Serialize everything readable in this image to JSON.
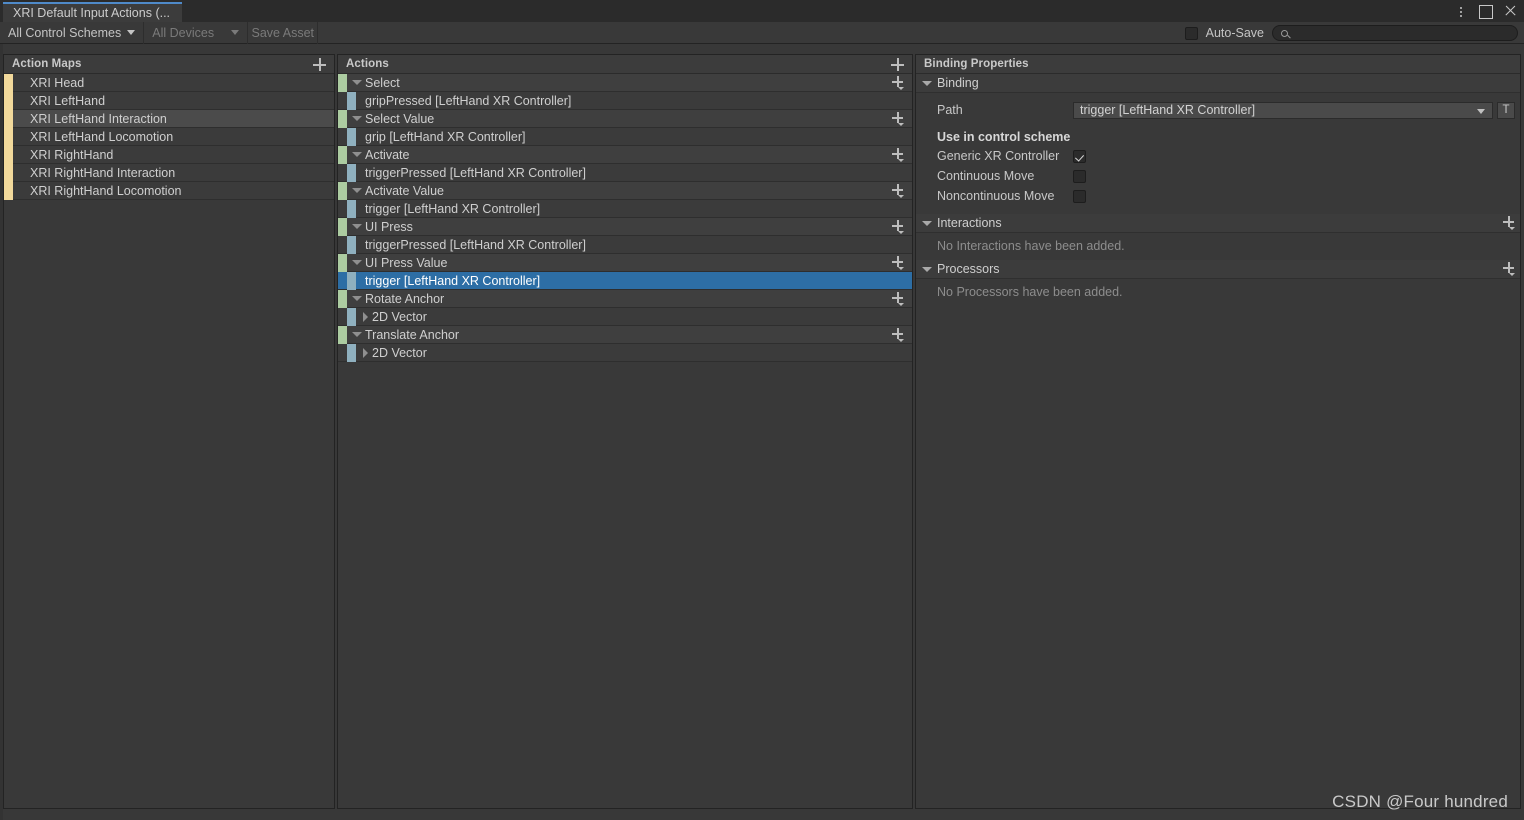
{
  "window": {
    "tab_title": "XRI Default Input Actions (...",
    "buttons": {
      "kebab": "more-options",
      "maximize": "maximize",
      "close": "close"
    }
  },
  "toolbar": {
    "control_schemes": "All Control Schemes",
    "devices": "All Devices",
    "save_asset": "Save Asset",
    "auto_save_label": "Auto-Save",
    "auto_save_checked": false,
    "search_value": "",
    "search_placeholder": ""
  },
  "action_maps": {
    "title": "Action Maps",
    "add_label": "+",
    "items": [
      {
        "label": "XRI Head",
        "selected": false
      },
      {
        "label": "XRI LeftHand",
        "selected": false
      },
      {
        "label": "XRI LeftHand Interaction",
        "selected": true
      },
      {
        "label": "XRI LeftHand Locomotion",
        "selected": false
      },
      {
        "label": "XRI RightHand",
        "selected": false
      },
      {
        "label": "XRI RightHand Interaction",
        "selected": false
      },
      {
        "label": "XRI RightHand Locomotion",
        "selected": false
      }
    ]
  },
  "actions": {
    "title": "Actions",
    "add_label": "+",
    "rows": [
      {
        "kind": "action",
        "label": "Select",
        "expanded": true
      },
      {
        "kind": "binding",
        "label": "gripPressed [LeftHand XR Controller]",
        "selected": false
      },
      {
        "kind": "action",
        "label": "Select Value",
        "expanded": true
      },
      {
        "kind": "binding",
        "label": "grip [LeftHand XR Controller]",
        "selected": false
      },
      {
        "kind": "action",
        "label": "Activate",
        "expanded": true
      },
      {
        "kind": "binding",
        "label": "triggerPressed [LeftHand XR Controller]",
        "selected": false
      },
      {
        "kind": "action",
        "label": "Activate Value",
        "expanded": true
      },
      {
        "kind": "binding",
        "label": "trigger [LeftHand XR Controller]",
        "selected": false
      },
      {
        "kind": "action",
        "label": "UI Press",
        "expanded": true
      },
      {
        "kind": "binding",
        "label": "triggerPressed [LeftHand XR Controller]",
        "selected": false
      },
      {
        "kind": "action",
        "label": "UI Press Value",
        "expanded": true
      },
      {
        "kind": "binding",
        "label": "trigger [LeftHand XR Controller]",
        "selected": true
      },
      {
        "kind": "action",
        "label": "Rotate Anchor",
        "expanded": true
      },
      {
        "kind": "composite",
        "label": "2D Vector",
        "expanded": false
      },
      {
        "kind": "action",
        "label": "Translate Anchor",
        "expanded": true
      },
      {
        "kind": "composite",
        "label": "2D Vector",
        "expanded": false
      }
    ]
  },
  "binding_properties": {
    "title": "Binding Properties",
    "binding_section": {
      "title": "Binding",
      "path_label": "Path",
      "path_value": "trigger [LeftHand XR Controller]",
      "picker_button_label": "T",
      "control_scheme_header": "Use in control scheme",
      "schemes": [
        {
          "label": "Generic XR Controller",
          "checked": true
        },
        {
          "label": "Continuous Move",
          "checked": false
        },
        {
          "label": "Noncontinuous Move",
          "checked": false
        }
      ]
    },
    "interactions_section": {
      "title": "Interactions",
      "empty_text": "No Interactions have been added.",
      "add_label": "+"
    },
    "processors_section": {
      "title": "Processors",
      "empty_text": "No Processors have been added.",
      "add_label": "+"
    }
  },
  "watermark": "CSDN @Four hundred",
  "colors": {
    "selection_blue": "#2d6ea5",
    "action_swatch": "#accca1",
    "binding_swatch": "#8fb0bf",
    "map_swatch": "#f2d99b",
    "tab_accent": "#4f8ac9"
  }
}
